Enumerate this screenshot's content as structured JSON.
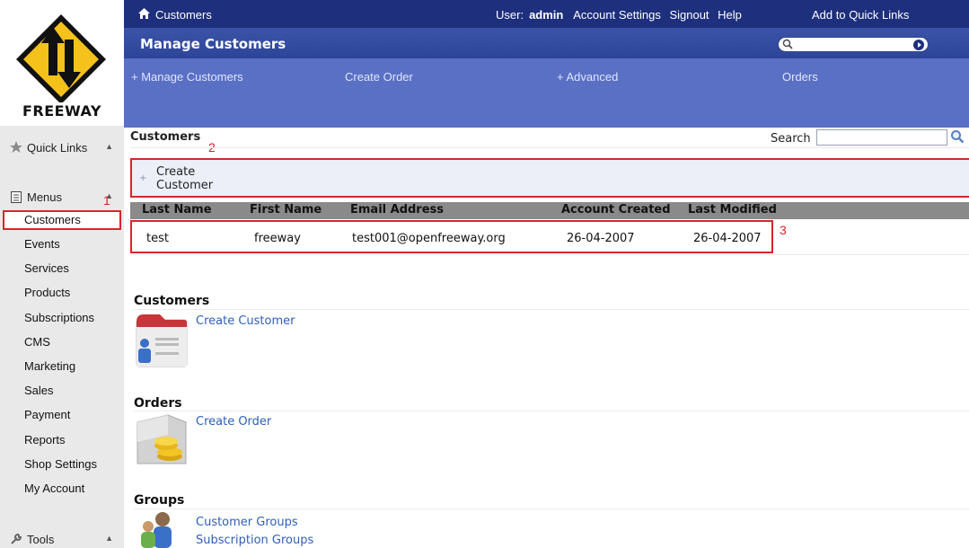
{
  "app": {
    "logo_text": "FREEWAY"
  },
  "topbar": {
    "breadcrumb": "Customers",
    "user_label": "User:",
    "user_name": "admin",
    "account_settings": "Account Settings",
    "signout": "Signout",
    "help": "Help",
    "add_quick_links": "Add to Quick Links"
  },
  "titlebar": {
    "title": "Manage Customers",
    "search_value": ""
  },
  "subnav": {
    "items": [
      {
        "label": "+ Manage Customers"
      },
      {
        "label": "Create Order"
      },
      {
        "label": "+ Advanced"
      },
      {
        "label": "Orders"
      }
    ]
  },
  "sidebar": {
    "quick_links": "Quick Links",
    "menus": "Menus",
    "tools": "Tools",
    "items": [
      {
        "label": "Customers"
      },
      {
        "label": "Events"
      },
      {
        "label": "Services"
      },
      {
        "label": "Products"
      },
      {
        "label": "Subscriptions"
      },
      {
        "label": "CMS"
      },
      {
        "label": "Marketing"
      },
      {
        "label": "Sales"
      },
      {
        "label": "Payment"
      },
      {
        "label": "Reports"
      },
      {
        "label": "Shop Settings"
      },
      {
        "label": "My Account"
      }
    ]
  },
  "annotations": {
    "one": "1",
    "two": "2",
    "three": "3"
  },
  "main": {
    "section_title": "Customers",
    "search_label": "Search",
    "search_value": "",
    "create_button": "Create Customer",
    "table": {
      "columns": [
        "Last Name",
        "First Name",
        "Email Address",
        "Account Created",
        "Last Modified"
      ],
      "rows": [
        [
          "test",
          "freeway",
          "test001@openfreeway.org",
          "26-04-2007",
          "26-04-2007"
        ]
      ]
    },
    "groups": [
      {
        "title": "Customers",
        "links": [
          "Create Customer"
        ]
      },
      {
        "title": "Orders",
        "links": [
          "Create Order"
        ]
      },
      {
        "title": "Groups",
        "links": [
          "Customer Groups",
          "Subscription Groups"
        ]
      }
    ]
  },
  "colors": {
    "highlight": "#d7262b",
    "topbar": "#1d2f7d",
    "subnav": "#5a70c4",
    "link": "#2f5fb8"
  }
}
